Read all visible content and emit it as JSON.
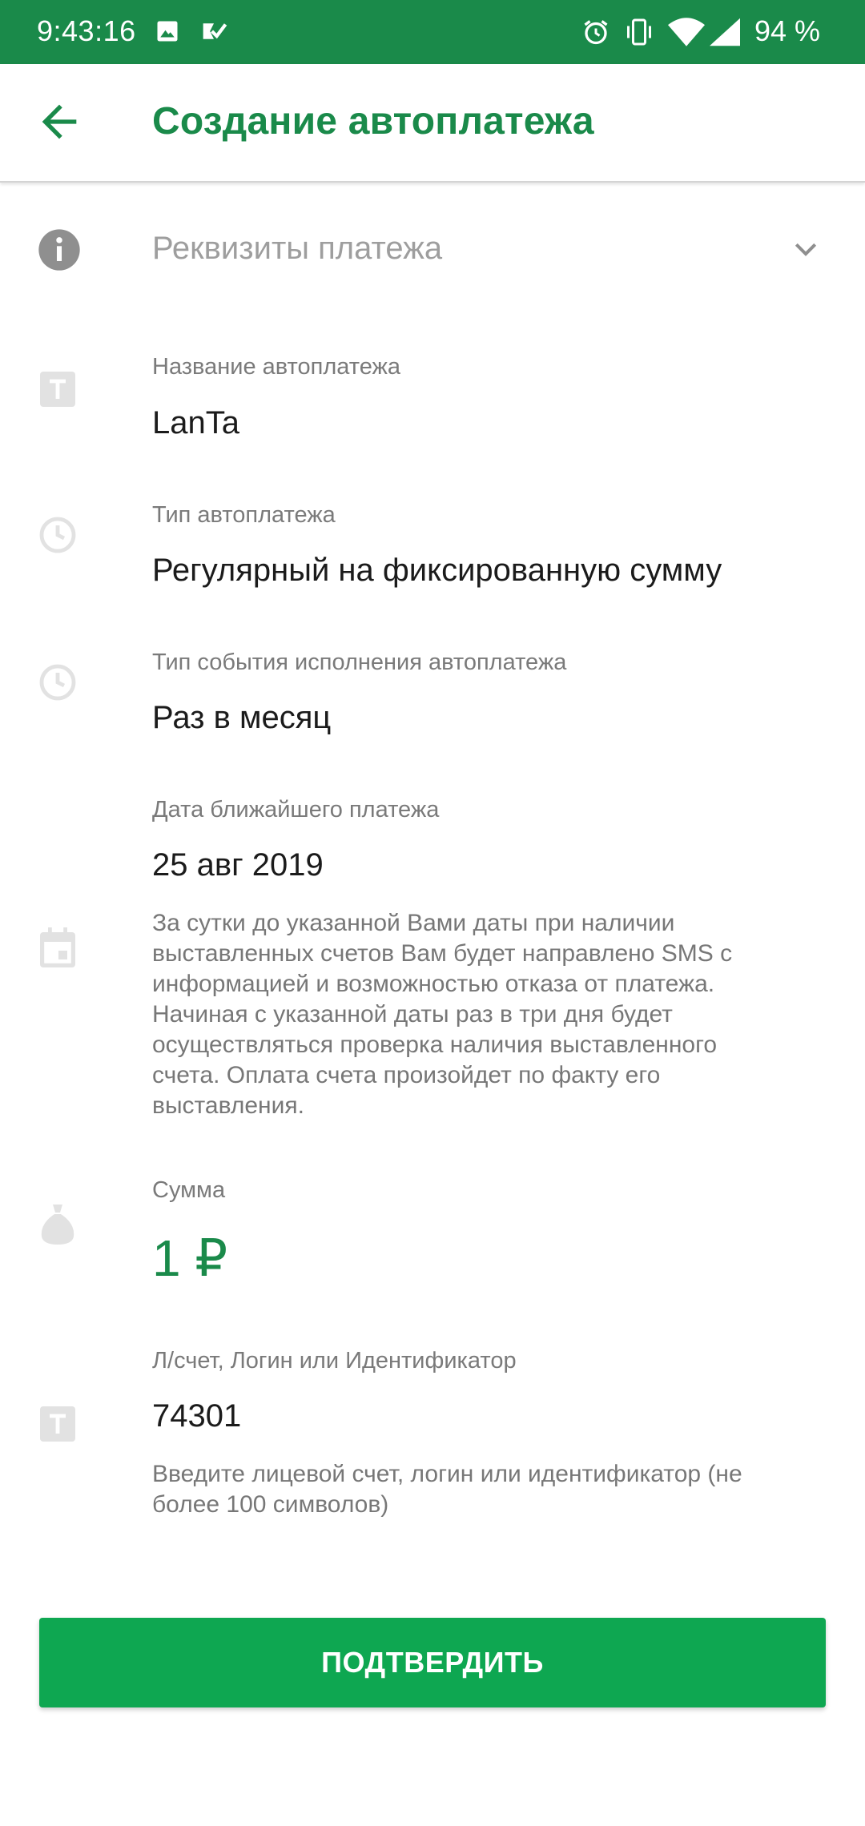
{
  "status_bar": {
    "time": "9:43:16",
    "battery": "94 %",
    "icons": [
      "image-icon",
      "task-check-icon",
      "alarm-icon",
      "vibrate-icon",
      "wifi-icon",
      "signal-icon"
    ]
  },
  "header": {
    "title": "Создание автоплатежа",
    "back_icon": "arrow-left-icon"
  },
  "section": {
    "label": "Реквизиты платежа",
    "icon": "info-icon",
    "chevron": "chevron-down-icon"
  },
  "fields": {
    "name": {
      "label": "Название автоплатежа",
      "value": "LanTa",
      "icon": "text-field-icon"
    },
    "type": {
      "label": "Тип автоплатежа",
      "value": "Регулярный на фиксированную сумму",
      "icon": "clock-icon"
    },
    "event": {
      "label": "Тип события исполнения автоплатежа",
      "value": "Раз в месяц",
      "icon": "clock-icon"
    },
    "date": {
      "label": "Дата ближайшего платежа",
      "value": "25 авг 2019",
      "icon": "calendar-icon",
      "hint_lines": [
        "За сутки до указанной Вами даты при наличии",
        "выставленных счетов Вам будет направлено SMS с",
        "информацией и возможностью отказа от платежа.",
        "Начиная с указанной даты раз в три дня будет",
        "осуществляться проверка наличия выставленного",
        "счета. Оплата счета произойдет по факту его",
        "выставления."
      ]
    },
    "amount": {
      "label": "Сумма",
      "value": "1 ₽",
      "icon": "money-bag-icon"
    },
    "account": {
      "label": "Л/счет, Логин или Идентификатор",
      "value": "74301",
      "icon": "text-field-icon",
      "hint_lines": [
        "Введите лицевой счет, логин или идентификатор (не",
        "более 100 символов)"
      ]
    }
  },
  "confirm_button": {
    "label": "ПОДТВЕРДИТЬ"
  },
  "colors": {
    "brand_green": "#1a8a4a",
    "button_green": "#0ea751",
    "icon_gray": "#e2e2e2",
    "label_gray": "#7a7a7a"
  }
}
